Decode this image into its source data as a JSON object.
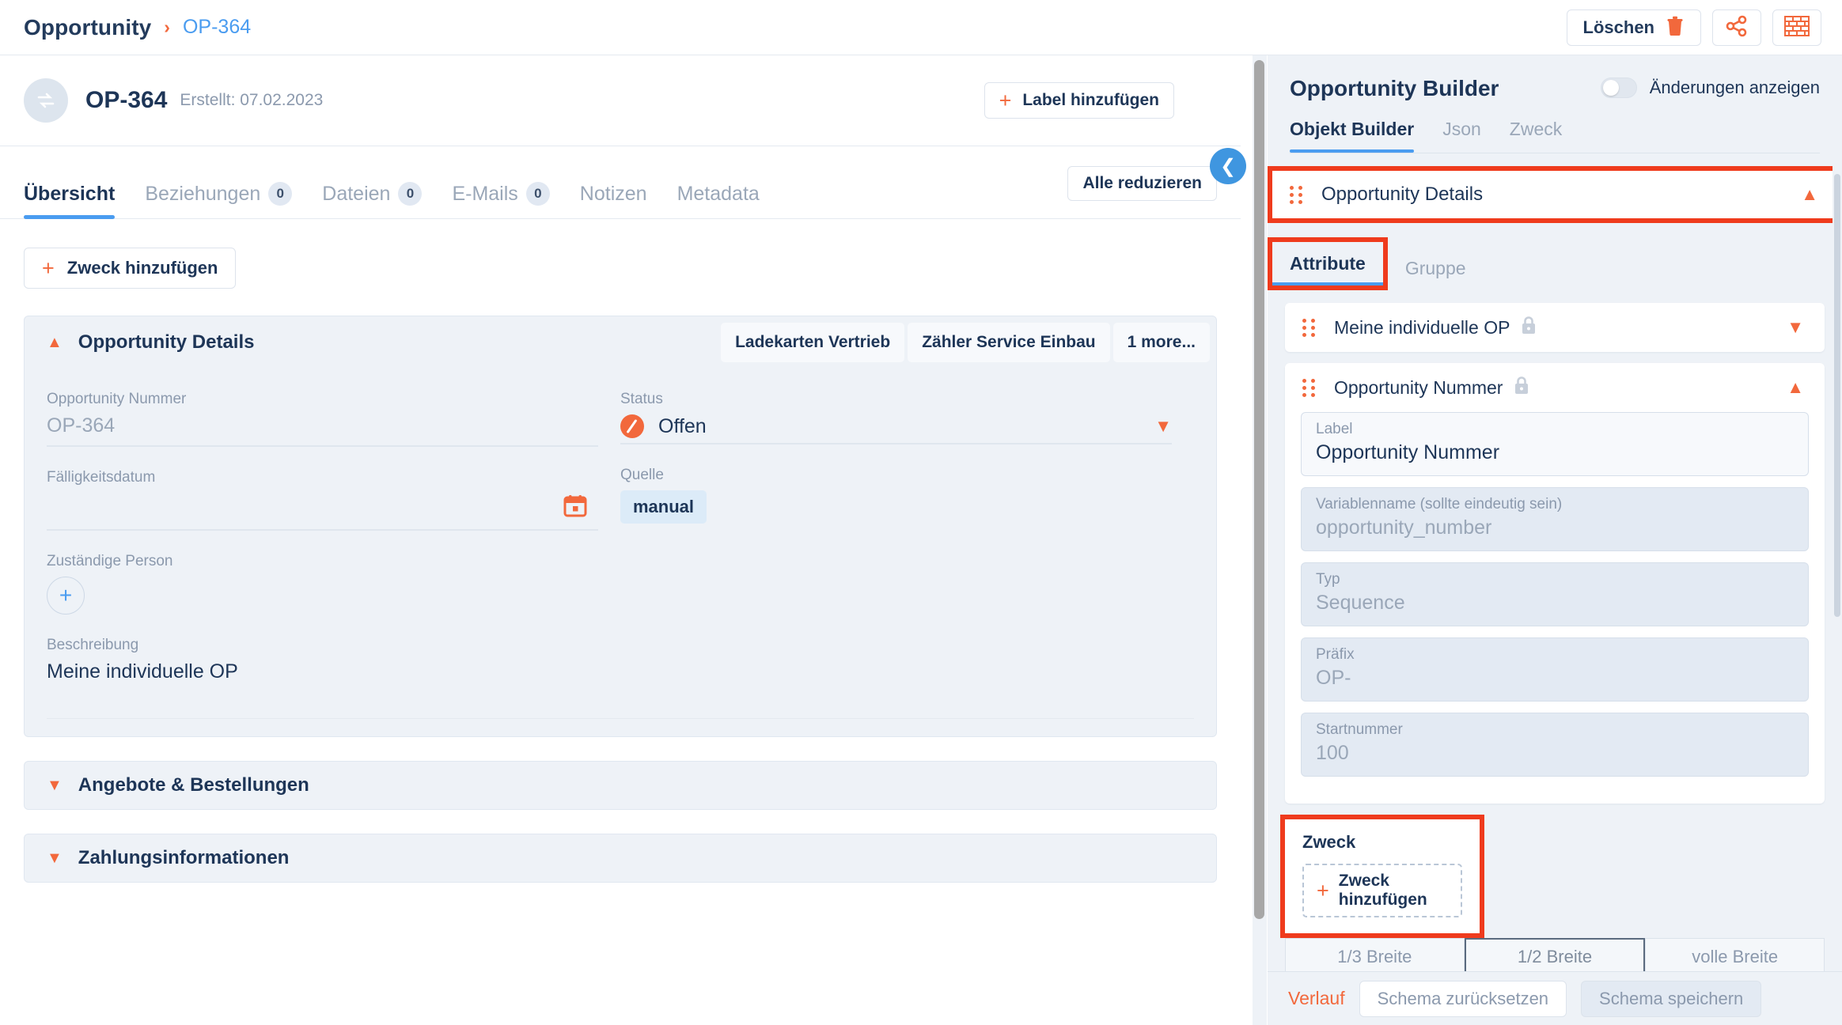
{
  "topbar": {
    "breadcrumb_root": "Opportunity",
    "breadcrumb_separator": "›",
    "breadcrumb_current": "OP-364",
    "delete_label": "Löschen",
    "delete_icon": "trash-icon",
    "share_icon": "share-icon",
    "bricks_icon": "bricks-icon"
  },
  "record": {
    "avatar_icon": "repeat-icon",
    "title": "OP-364",
    "created": "Erstellt: 07.02.2023",
    "add_label_button": "Label hinzufügen",
    "collapse_pane_icon": "chevron-left-icon"
  },
  "tabs": {
    "items": [
      {
        "label": "Übersicht",
        "badge": "",
        "active": true
      },
      {
        "label": "Beziehungen",
        "badge": "0",
        "active": false
      },
      {
        "label": "Dateien",
        "badge": "0",
        "active": false
      },
      {
        "label": "E-Mails",
        "badge": "0",
        "active": false
      },
      {
        "label": "Notizen",
        "badge": "",
        "active": false
      },
      {
        "label": "Metadata",
        "badge": "",
        "active": false
      }
    ],
    "collapse_all": "Alle reduzieren"
  },
  "content": {
    "add_purpose_button": "Zweck hinzufügen",
    "section": {
      "title": "Opportunity Details",
      "chips": [
        "Ladekarten Vertrieb",
        "Zähler Service Einbau",
        "1 more..."
      ]
    },
    "fields": {
      "opportunity_nummer_label": "Opportunity Nummer",
      "opportunity_nummer_value": "OP-364",
      "status_label": "Status",
      "status_value": "Offen",
      "faelligkeitsdatum_label": "Fälligkeitsdatum",
      "faelligkeitsdatum_value": "",
      "quelle_label": "Quelle",
      "quelle_value": "manual",
      "zustaendige_person_label": "Zuständige Person",
      "beschreibung_label": "Beschreibung",
      "beschreibung_value": "Meine individuelle OP"
    },
    "collapsed_sections": [
      "Angebote & Bestellungen",
      "Zahlungsinformationen"
    ]
  },
  "builder": {
    "title": "Opportunity Builder",
    "toggle_label": "Änderungen anzeigen",
    "tabs": [
      {
        "label": "Objekt Builder",
        "active": true
      },
      {
        "label": "Json",
        "active": false
      },
      {
        "label": "Zweck",
        "active": false
      }
    ],
    "section_header": {
      "title": "Opportunity Details",
      "chevron": "chevron-up-icon"
    },
    "sub_tabs": [
      {
        "label": "Attribute",
        "active": true
      },
      {
        "label": "Gruppe",
        "active": false
      }
    ],
    "attributes": [
      {
        "name": "Meine individuelle OP",
        "locked": true,
        "expanded": false,
        "chevron": "chevron-down-icon"
      },
      {
        "name": "Opportunity Nummer",
        "locked": true,
        "expanded": true,
        "chevron": "chevron-up-icon",
        "fields": [
          {
            "label": "Label",
            "value": "Opportunity Nummer",
            "editable": true
          },
          {
            "label": "Variablenname (sollte eindeutig sein)",
            "value": "opportunity_number",
            "editable": false
          },
          {
            "label": "Typ",
            "value": "Sequence",
            "editable": false
          },
          {
            "label": "Präfix",
            "value": "OP-",
            "editable": false
          },
          {
            "label": "Startnummer",
            "value": "100",
            "editable": false
          }
        ]
      }
    ],
    "zweck": {
      "title": "Zweck",
      "add_button": "Zweck hinzufügen"
    },
    "width_options": [
      {
        "label": "1/3 Breite",
        "selected": false
      },
      {
        "label": "1/2 Breite",
        "selected": true
      },
      {
        "label": "volle Breite",
        "selected": false
      }
    ],
    "footer": {
      "history_link": "Verlauf",
      "reset_button": "Schema zurücksetzen",
      "save_button": "Schema speichern"
    }
  },
  "colors": {
    "accent_orange": "#f2683c",
    "accent_blue": "#4a9cf0",
    "highlight_red": "#ef3b1d",
    "text_dark": "#1d3557",
    "text_muted": "#8b99ad",
    "panel_bg": "#eef2f7"
  }
}
